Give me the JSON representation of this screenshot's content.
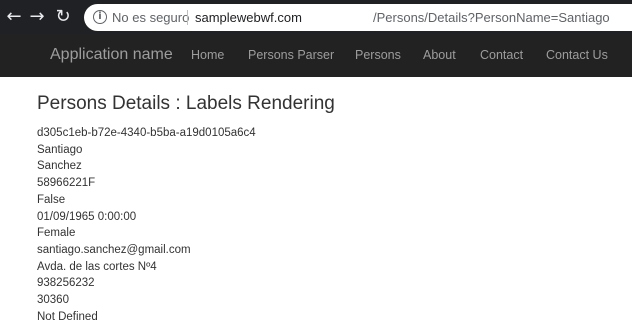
{
  "browser": {
    "back_icon": "back-arrow-icon",
    "forward_icon": "forward-arrow-icon",
    "reload_icon": "reload-icon",
    "security_text": "No es seguro",
    "url_host": "samplewebwf.com",
    "url_path": "/Persons/Details?PersonName=Santiago"
  },
  "navbar": {
    "brand": "Application name",
    "items": [
      "Home",
      "Persons Parser",
      "Persons",
      "About",
      "Contact",
      "Contact Us"
    ]
  },
  "page": {
    "title": "Persons Details : Labels Rendering",
    "lines": [
      "d305c1eb-b72e-4340-b5ba-a19d0105a6c4",
      "Santiago",
      "Sanchez",
      "58966221F",
      "False",
      "01/09/1965 0:00:00",
      "Female",
      "santiago.sanchez@gmail.com",
      "Avda. de las cortes Nº4",
      "938256232",
      "30360",
      "Not Defined"
    ]
  }
}
